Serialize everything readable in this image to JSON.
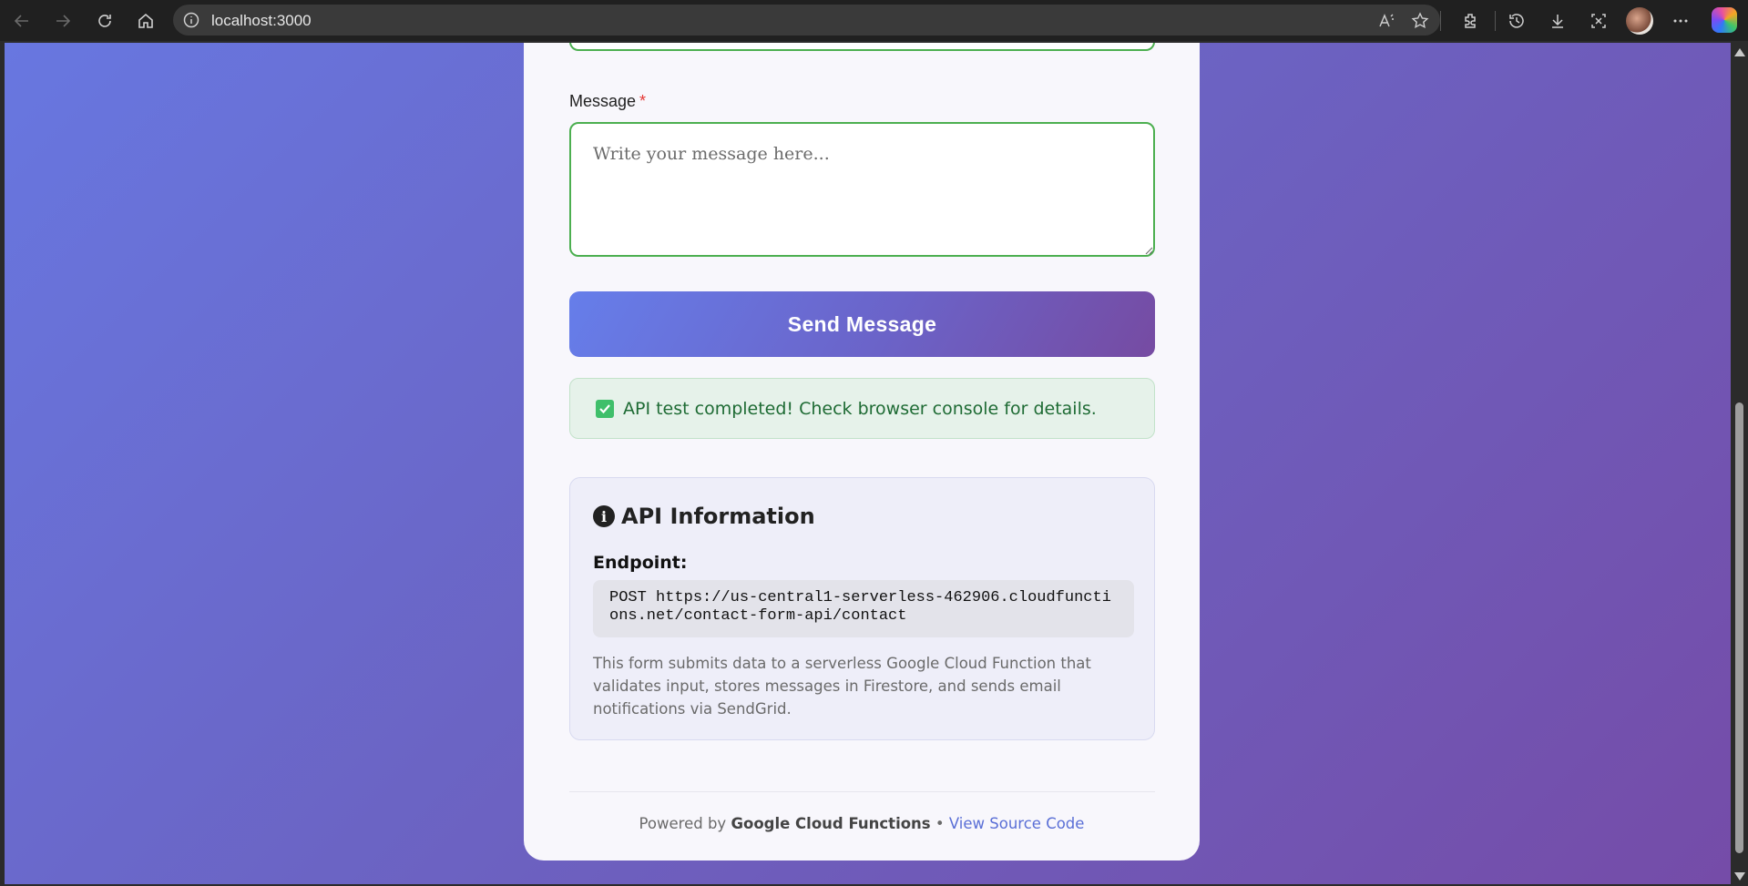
{
  "browser": {
    "url": "localhost:3000",
    "nav_icons": [
      "back-icon",
      "forward-icon",
      "refresh-icon",
      "home-icon"
    ],
    "address_icons": [
      "site-info-icon",
      "read-aloud-icon",
      "favorite-star-icon"
    ],
    "toolbar_icons": [
      "extensions-icon",
      "history-icon",
      "downloads-icon",
      "screenshot-icon",
      "profile-avatar",
      "more-icon",
      "copilot-icon"
    ]
  },
  "form": {
    "message_label": "Message",
    "required_mark": "*",
    "message_placeholder": "Write your message here...",
    "message_value": "",
    "submit_label": "Send Message",
    "status_message": "API test completed! Check browser console for details."
  },
  "api_info": {
    "title": "API Information",
    "endpoint_label": "Endpoint:",
    "endpoint": "POST https://us-central1-serverless-462906.cloudfunctions.net/contact-form-api/contact",
    "description": "This form submits data to a serverless Google Cloud Function that validates input, stores messages in Firestore, and sends email notifications via SendGrid."
  },
  "footer": {
    "powered_by": "Powered by",
    "platform": "Google Cloud Functions",
    "separator": "•",
    "source_link": "View Source Code"
  },
  "colors": {
    "gradient_start": "#667eea",
    "gradient_end": "#764ba2",
    "valid_border": "#4caf50",
    "success_text": "#1e6b34",
    "link": "#5a6fd6"
  }
}
